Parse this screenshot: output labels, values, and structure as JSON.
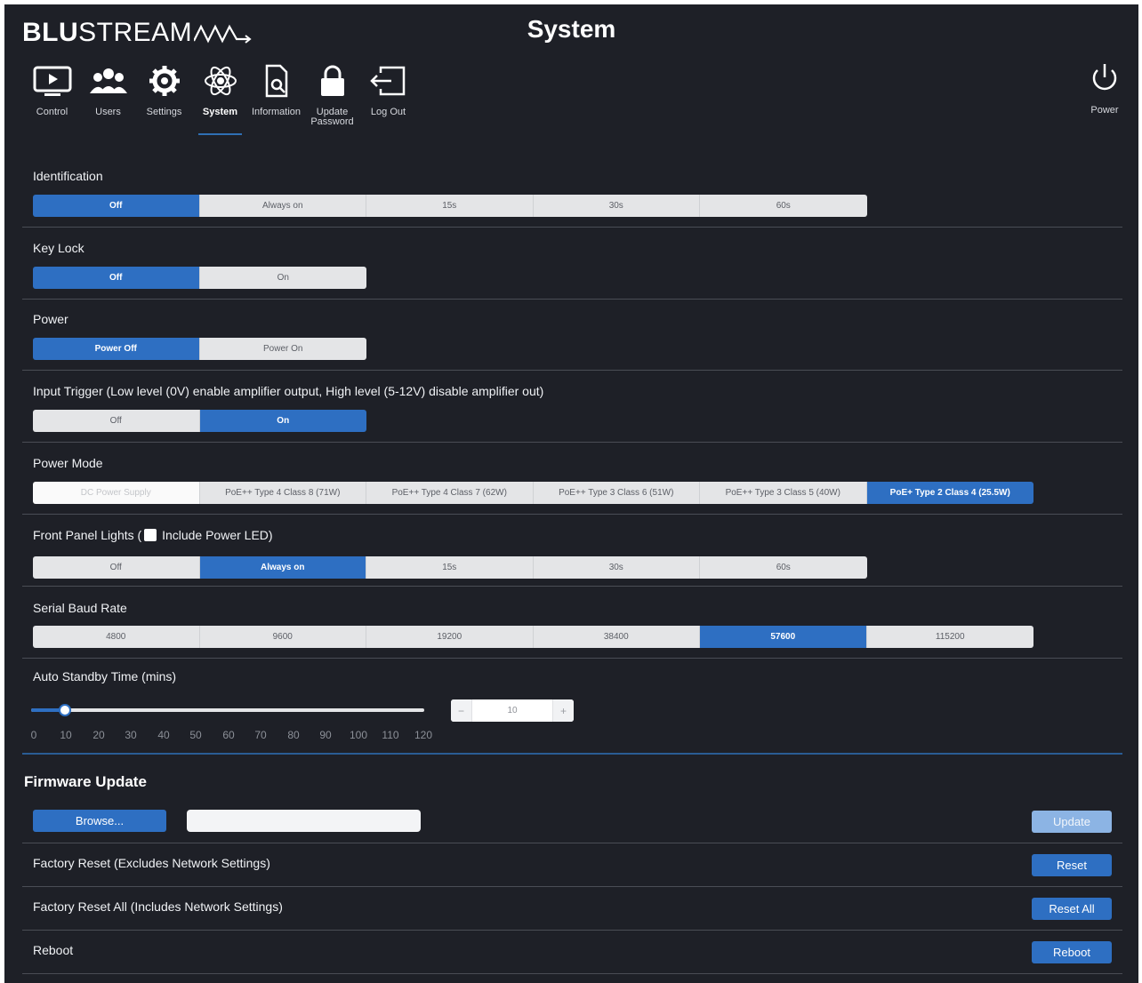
{
  "header": {
    "logo_bold": "BLU",
    "logo_light": "STREAM",
    "title": "System",
    "power_label": "Power"
  },
  "nav": [
    {
      "label": "Control",
      "icon": "monitor-play-icon"
    },
    {
      "label": "Users",
      "icon": "users-icon"
    },
    {
      "label": "Settings",
      "icon": "gear-icon"
    },
    {
      "label": "System",
      "icon": "atom-icon",
      "active": true
    },
    {
      "label": "Information",
      "icon": "document-search-icon"
    },
    {
      "label": "Update\nPassword",
      "icon": "lock-icon"
    },
    {
      "label": "Log Out",
      "icon": "logout-icon"
    }
  ],
  "identification": {
    "title": "Identification",
    "options": [
      "Off",
      "Always on",
      "15s",
      "30s",
      "60s"
    ],
    "selected": "Off"
  },
  "key_lock": {
    "title": "Key Lock",
    "options": [
      "Off",
      "On"
    ],
    "selected": "Off"
  },
  "power": {
    "title": "Power",
    "options": [
      "Power Off",
      "Power On"
    ],
    "selected": "Power Off"
  },
  "input_trigger": {
    "title": "Input Trigger (Low level (0V) enable amplifier output, High level (5-12V) disable amplifier out)",
    "options": [
      "Off",
      "On"
    ],
    "selected": "On"
  },
  "power_mode": {
    "title": "Power Mode",
    "options": [
      "DC Power Supply",
      "PoE++ Type 4 Class 8 (71W)",
      "PoE++ Type 4 Class 7 (62W)",
      "PoE++ Type 3 Class 6 (51W)",
      "PoE++ Type 3 Class 5 (40W)",
      "PoE+ Type 2 Class 4 (25.5W)"
    ],
    "selected": "PoE+ Type 2 Class 4 (25.5W)"
  },
  "front_panel": {
    "title_pre": "Front Panel Lights (",
    "title_post": "Include Power LED)",
    "include_power_led": false,
    "options": [
      "Off",
      "Always on",
      "15s",
      "30s",
      "60s"
    ],
    "selected": "Always on"
  },
  "baud": {
    "title": "Serial Baud Rate",
    "options": [
      "4800",
      "9600",
      "19200",
      "38400",
      "57600",
      "115200"
    ],
    "selected": "57600"
  },
  "standby": {
    "title": "Auto Standby Time (mins)",
    "ticks": [
      "0",
      "10",
      "20",
      "30",
      "40",
      "50",
      "60",
      "70",
      "80",
      "90",
      "100",
      "110",
      "120"
    ],
    "value": "10",
    "minus": "−",
    "plus": "+"
  },
  "firmware": {
    "title": "Firmware Update",
    "browse_label": "Browse...",
    "update_label": "Update",
    "factory_reset_label": "Factory Reset (Excludes Network Settings)",
    "reset_label": "Reset",
    "factory_reset_all_label": "Factory Reset All (Includes Network Settings)",
    "reset_all_label": "Reset All",
    "reboot_row_label": "Reboot",
    "reboot_label": "Reboot"
  },
  "colors": {
    "background": "#1e2027",
    "accent": "#2e6fc2",
    "segment": "#e4e5e7"
  }
}
